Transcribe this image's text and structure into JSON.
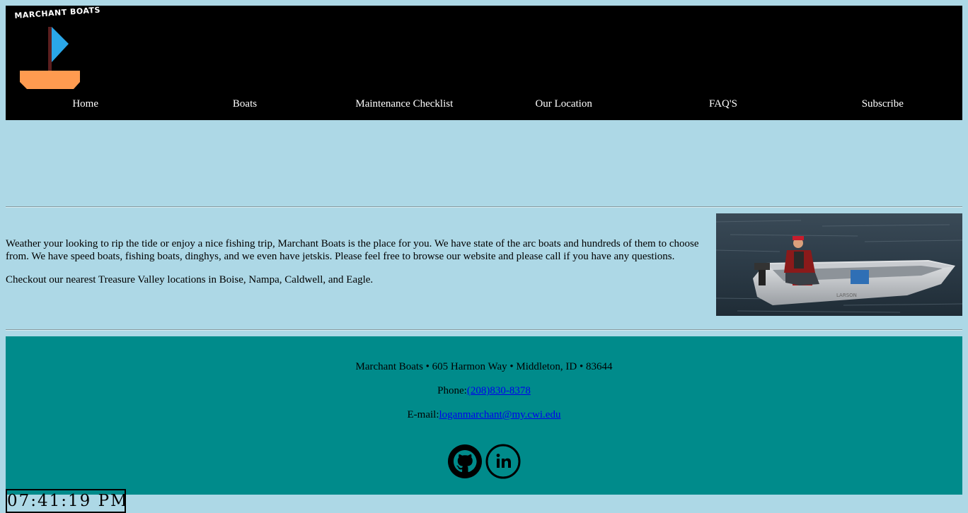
{
  "logo": {
    "text": "MARCHANT BOATS",
    "hull_color": "#FF9B50",
    "sail_color": "#2AA7E8",
    "mast_color": "#5A1E1E"
  },
  "nav": {
    "items": [
      {
        "label": "Home"
      },
      {
        "label": "Boats"
      },
      {
        "label": "Maintenance Checklist"
      },
      {
        "label": "Our Location"
      },
      {
        "label": "FAQ'S"
      },
      {
        "label": "Subscribe"
      }
    ]
  },
  "main": {
    "paragraph1": "Weather your looking to rip the tide or enjoy a nice fishing trip, Marchant Boats is the place for you. We have state of the arc boats and hundreds of them to choose from. We have speed boats, fishing boats, dinghys, and we even have jetskis. Please feel free to browse our website and please call if you have any questions.",
    "paragraph2": "Checkout our nearest Treasure Valley locations in Boise, Nampa, Caldwell, and Eagle."
  },
  "footer": {
    "address": "Marchant Boats • 605 Harmon Way • Middleton, ID • 83644",
    "phone_label": "Phone:",
    "phone": "(208)830-8378",
    "email_label": "E-mail:",
    "email": "loganmarchant@my.cwi.edu",
    "background": "#008B8B",
    "social_icons": [
      "github-icon",
      "linkedin-icon"
    ]
  },
  "clock": {
    "time": "07:41:19 PM"
  },
  "colors": {
    "page_background": "#ADD8E6",
    "header_background": "#000000",
    "link": "#0000EE"
  }
}
